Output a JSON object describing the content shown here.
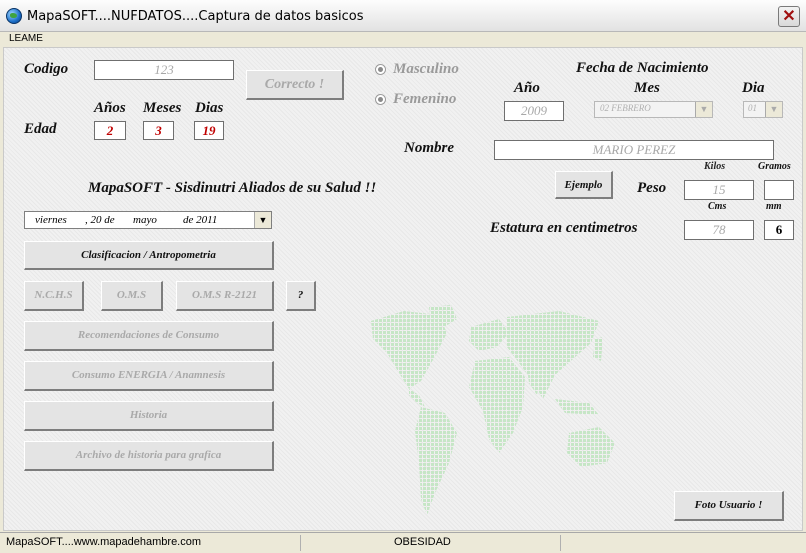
{
  "window": {
    "title": "MapaSOFT....NUFDATOS....Captura de datos basicos",
    "close_glyph": "✕"
  },
  "menu": {
    "items": [
      "LEAME"
    ]
  },
  "form": {
    "codigo_label": "Codigo",
    "codigo_value": "123",
    "correcto_button": "Correcto !",
    "edad": {
      "label": "Edad",
      "anios_label": "Años",
      "meses_label": "Meses",
      "dias_label": "Dias",
      "anios_value": "2",
      "meses_value": "3",
      "dias_value": "19"
    },
    "sexo": {
      "masculino_label": "Masculino",
      "femenino_label": "Femenino"
    },
    "fecha_nacimiento": {
      "title": "Fecha de Nacimiento",
      "anio_label": "Año",
      "mes_label": "Mes",
      "dia_label": "Dia",
      "anio_value": "2009",
      "mes_value": "02 FEBRERO",
      "dia_value": "01"
    },
    "nombre_label": "Nombre",
    "nombre_value": "MARIO PEREZ",
    "tagline": "MapaSOFT - Sisdinutri Aliados de su Salud  !!",
    "ejemplo_button": "Ejemplo",
    "peso": {
      "label": "Peso",
      "kilos_label": "Kilos",
      "gramos_label": "Gramos",
      "kilos_value": "15",
      "gramos_value": ""
    },
    "estatura": {
      "label": "Estatura en centimetros",
      "cms_label": "Cms",
      "mm_label": "mm",
      "cms_value": "78",
      "mm_value": "6"
    },
    "date_select": {
      "weekday": "viernes",
      "day": ", 20 de",
      "month": "mayo",
      "year": "de 2011"
    },
    "buttons": {
      "clasificacion": "Clasificacion / Antropometria",
      "nchs": "N.C.H.S",
      "oms": "O.M.S",
      "oms_r": "O.M.S R-2121",
      "help": "?",
      "recomendaciones": "Recomendaciones de Consumo",
      "consumo_energia": "Consumo ENERGIA / Anamnesis",
      "historia": "Historia",
      "archivo": "Archivo de historia para grafica",
      "foto_usuario": "Foto Usuario !"
    },
    "map_color": "#cfe9cf"
  },
  "statusbar": {
    "left": "MapaSOFT....www.mapadehambre.com",
    "center": "OBESIDAD"
  }
}
